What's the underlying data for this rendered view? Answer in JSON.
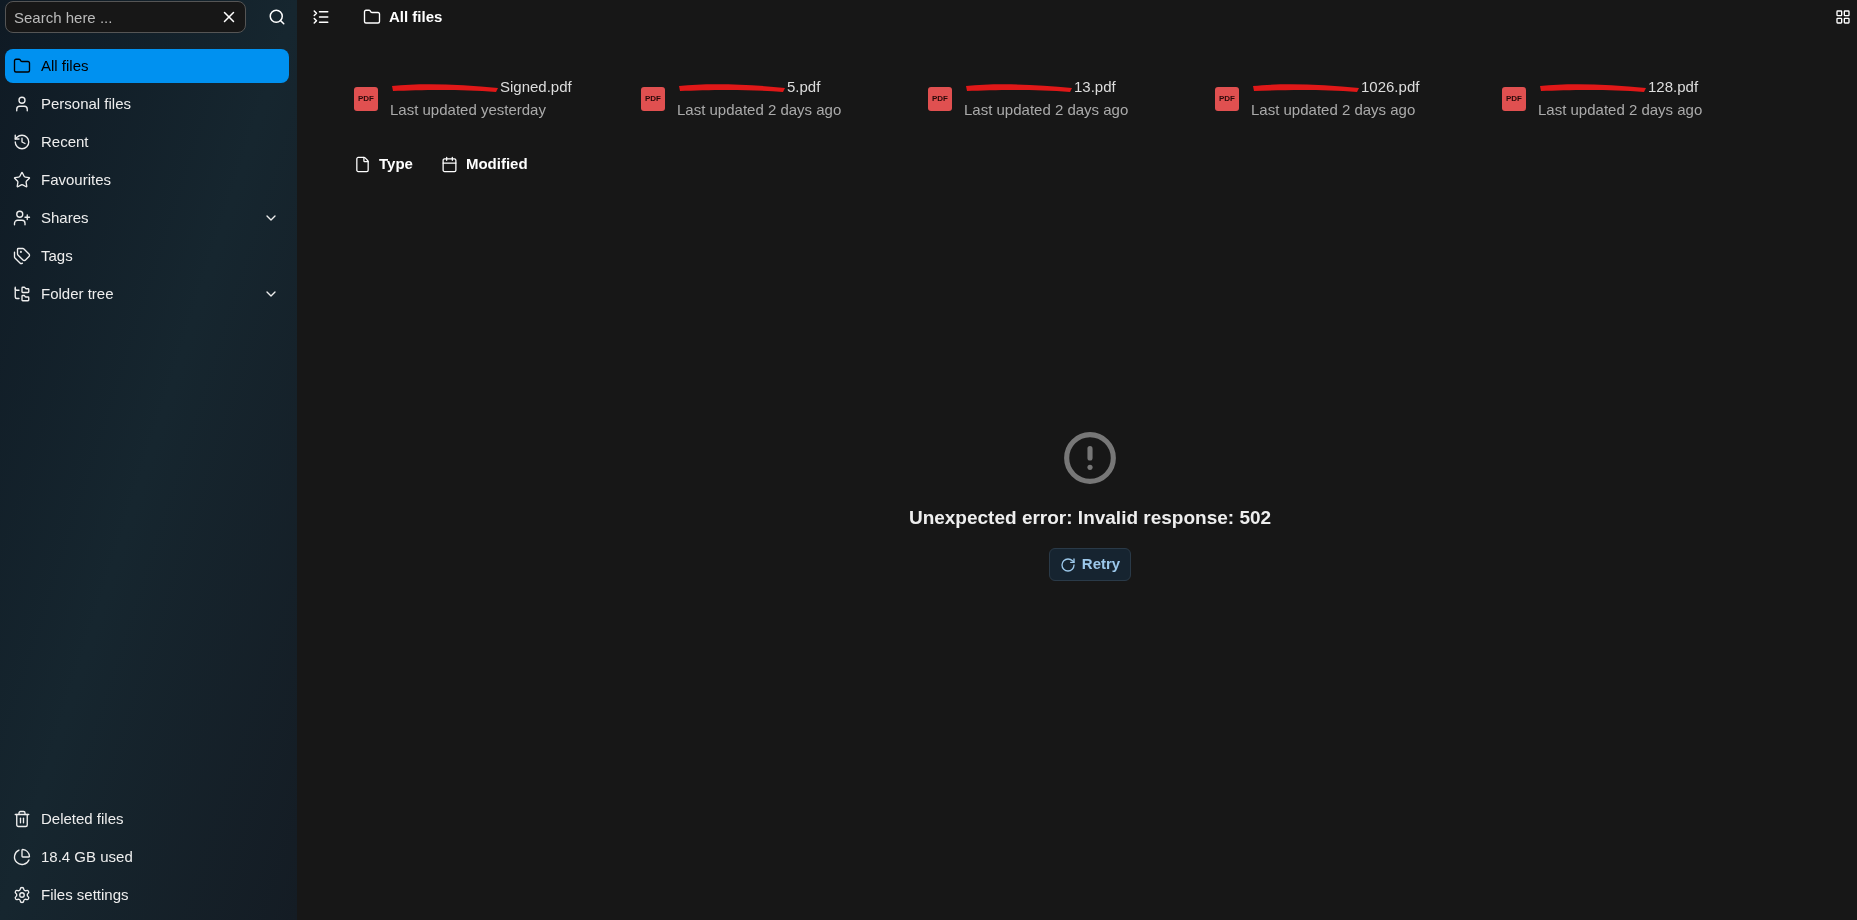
{
  "search": {
    "placeholder": "Search here ..."
  },
  "nav": [
    {
      "label": "All files",
      "selected": true
    },
    {
      "label": "Personal files",
      "selected": false
    },
    {
      "label": "Recent",
      "selected": false
    },
    {
      "label": "Favourites",
      "selected": false
    },
    {
      "label": "Shares",
      "selected": false,
      "expandable": true
    },
    {
      "label": "Tags",
      "selected": false
    },
    {
      "label": "Folder tree",
      "selected": false,
      "expandable": true
    }
  ],
  "footer": [
    {
      "label": "Deleted files"
    },
    {
      "label": "18.4 GB used"
    },
    {
      "label": "Files settings"
    }
  ],
  "header": {
    "title": "All files"
  },
  "recent_files": [
    {
      "badge": "PDF",
      "name": "Signed.pdf",
      "updated": "Last updated yesterday"
    },
    {
      "badge": "PDF",
      "name": "5.pdf",
      "updated": "Last updated 2 days ago"
    },
    {
      "badge": "PDF",
      "name": "13.pdf",
      "updated": "Last updated 2 days ago"
    },
    {
      "badge": "PDF",
      "name": "1026.pdf",
      "updated": "Last updated 2 days ago"
    },
    {
      "badge": "PDF",
      "name": "128.pdf",
      "updated": "Last updated 2 days ago"
    }
  ],
  "filters": [
    {
      "label": "Type"
    },
    {
      "label": "Modified"
    }
  ],
  "error": {
    "message": "Unexpected error: Invalid response: 502",
    "button": "Retry"
  }
}
